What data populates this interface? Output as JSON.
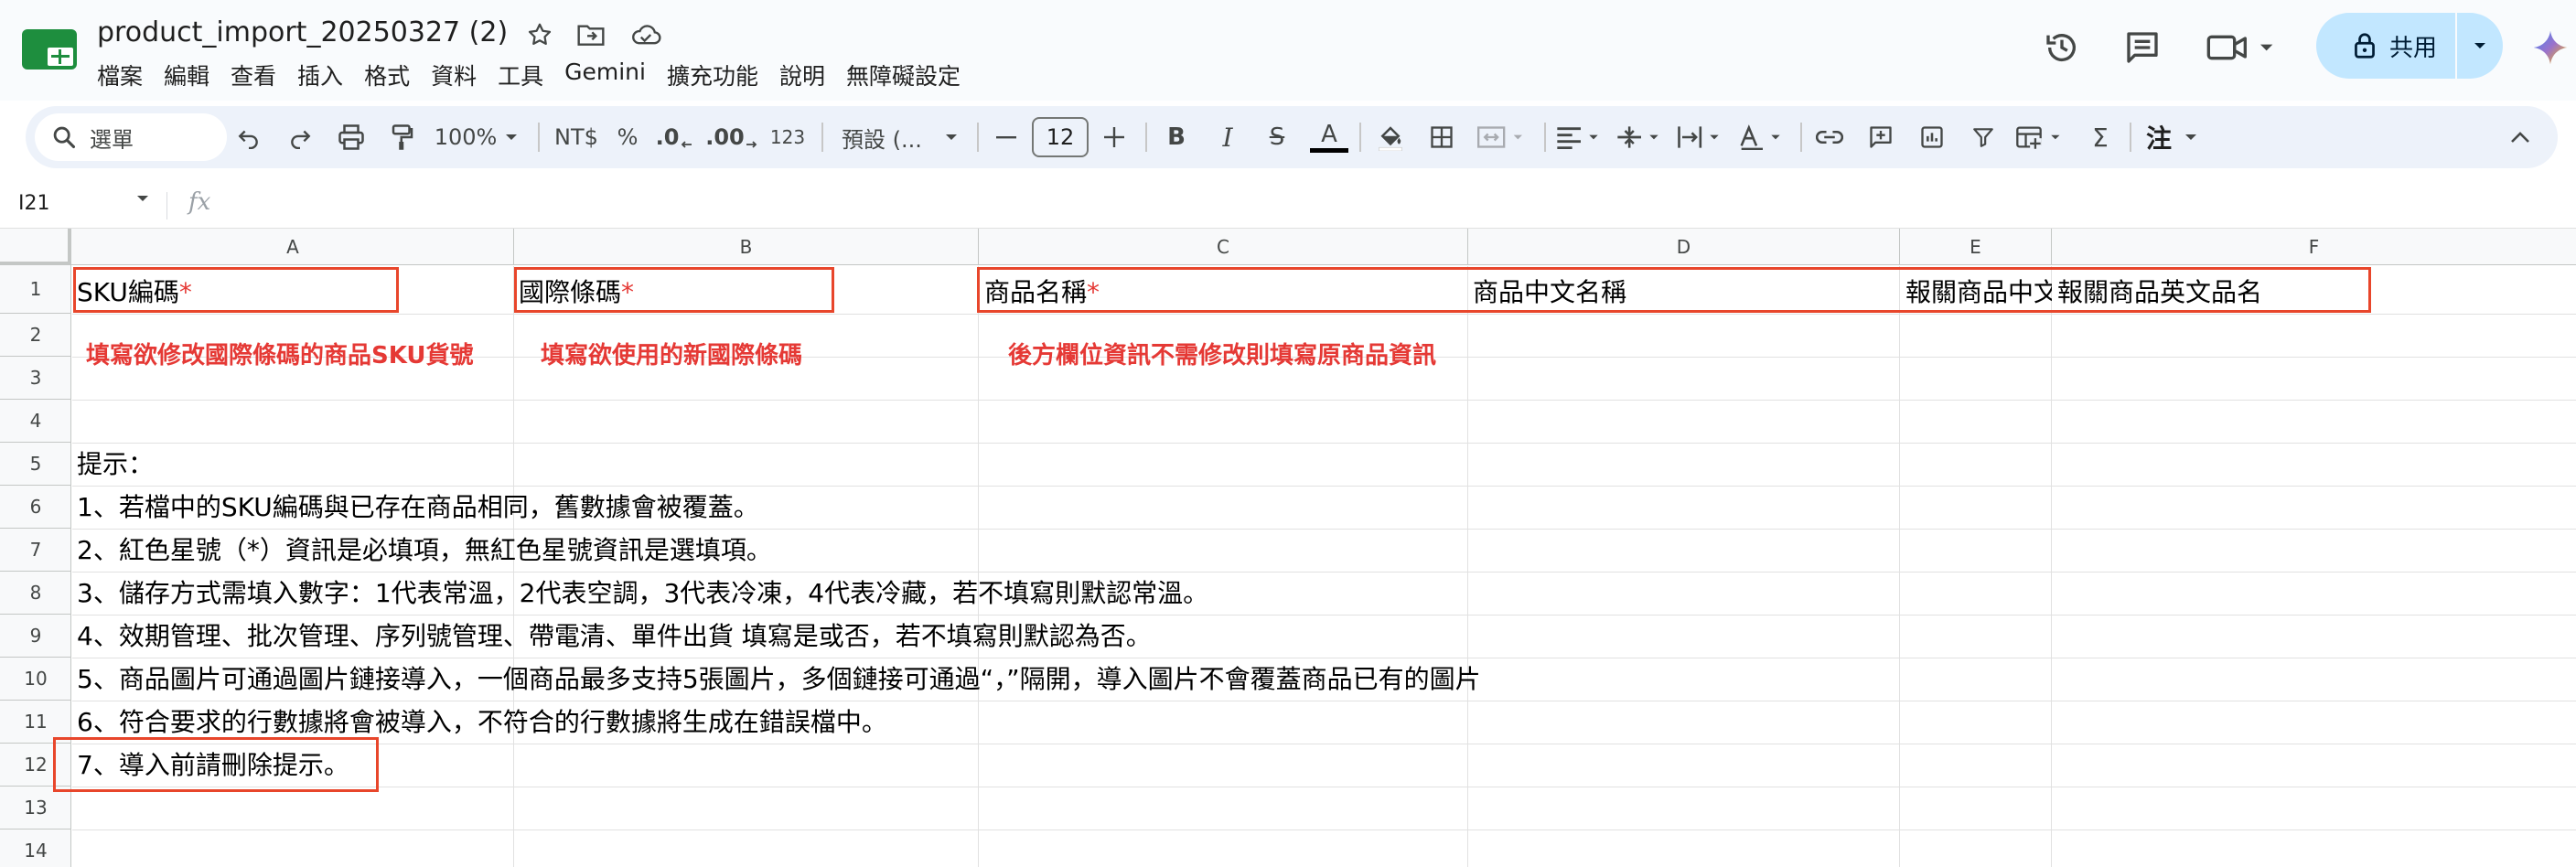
{
  "document": {
    "title": "product_import_20250327 (2)"
  },
  "menu": [
    "檔案",
    "編輯",
    "查看",
    "插入",
    "格式",
    "資料",
    "工具",
    "Gemini",
    "擴充功能",
    "說明",
    "無障礙設定"
  ],
  "share": {
    "label": "共用"
  },
  "toolbar": {
    "search_label": "選單",
    "zoom": "100%",
    "currency": "NT$",
    "percent": "%",
    "decrease_decimal": ".0",
    "increase_decimal": ".00",
    "number_format": "123",
    "font_name": "預設 (...",
    "font_size": "12",
    "bold": "B",
    "italic": "I",
    "strike": "S",
    "text_color": "A",
    "sum": "Σ",
    "input_tools": "注"
  },
  "formula_bar": {
    "cell_ref": "I21",
    "fx": "fx"
  },
  "columns": [
    "A",
    "B",
    "C",
    "D",
    "E",
    "F"
  ],
  "rows": [
    "1",
    "2",
    "3",
    "4",
    "5",
    "6",
    "7",
    "8",
    "9",
    "10",
    "11",
    "12",
    "13",
    "14"
  ],
  "cells": {
    "a1": "SKU編碼",
    "b1": "國際條碼",
    "c1": "商品名稱",
    "d1": "商品中文名稱",
    "e1": "報關商品中文品名",
    "f1": "報關商品英文品名",
    "required_mark": "*",
    "hint_a": "填寫欲修改國際條碼的商品SKU貨號",
    "hint_b": "填寫欲使用的新國際條碼",
    "hint_c": "後方欄位資訊不需修改則填寫原商品資訊",
    "tip_title": "提示：",
    "tip1": "1、若檔中的SKU編碼與已存在商品相同，舊數據會被覆蓋。",
    "tip2": "2、紅色星號（*）資訊是必填項，無紅色星號資訊是選填項。",
    "tip3": "3、儲存方式需填入數字：1代表常溫，2代表空調，3代表冷凍，4代表冷藏，若不填寫則默認常溫。",
    "tip4": "4、效期管理、批次管理、序列號管理、帶電清、單件出貨 填寫是或否，若不填寫則默認為否。",
    "tip5": "5、商品圖片可通過圖片鏈接導入，一個商品最多支持5張圖片，多個鏈接可通過“，”隔開，導入圖片不會覆蓋商品已有的圖片",
    "tip6": "6、符合要求的行數據將會被導入，不符合的行數據將生成在錯誤檔中。",
    "tip7": "7、導入前請刪除提示。"
  },
  "colors": {
    "title_bar_bg": "#f9fbfd",
    "toolbar_bg": "#edf2fa",
    "share_bg": "#c2e7ff",
    "highlight_red": "#e8462b",
    "required_red": "#e53935"
  },
  "icons": {
    "logo": "sheets-logo-icon",
    "star": "star-icon",
    "move": "folder-move-icon",
    "cloud": "cloud-status-icon",
    "history": "history-icon",
    "comments": "comment-icon",
    "meet": "video-call-icon",
    "lock": "lock-icon",
    "gemini": "gemini-sparkle-icon"
  }
}
